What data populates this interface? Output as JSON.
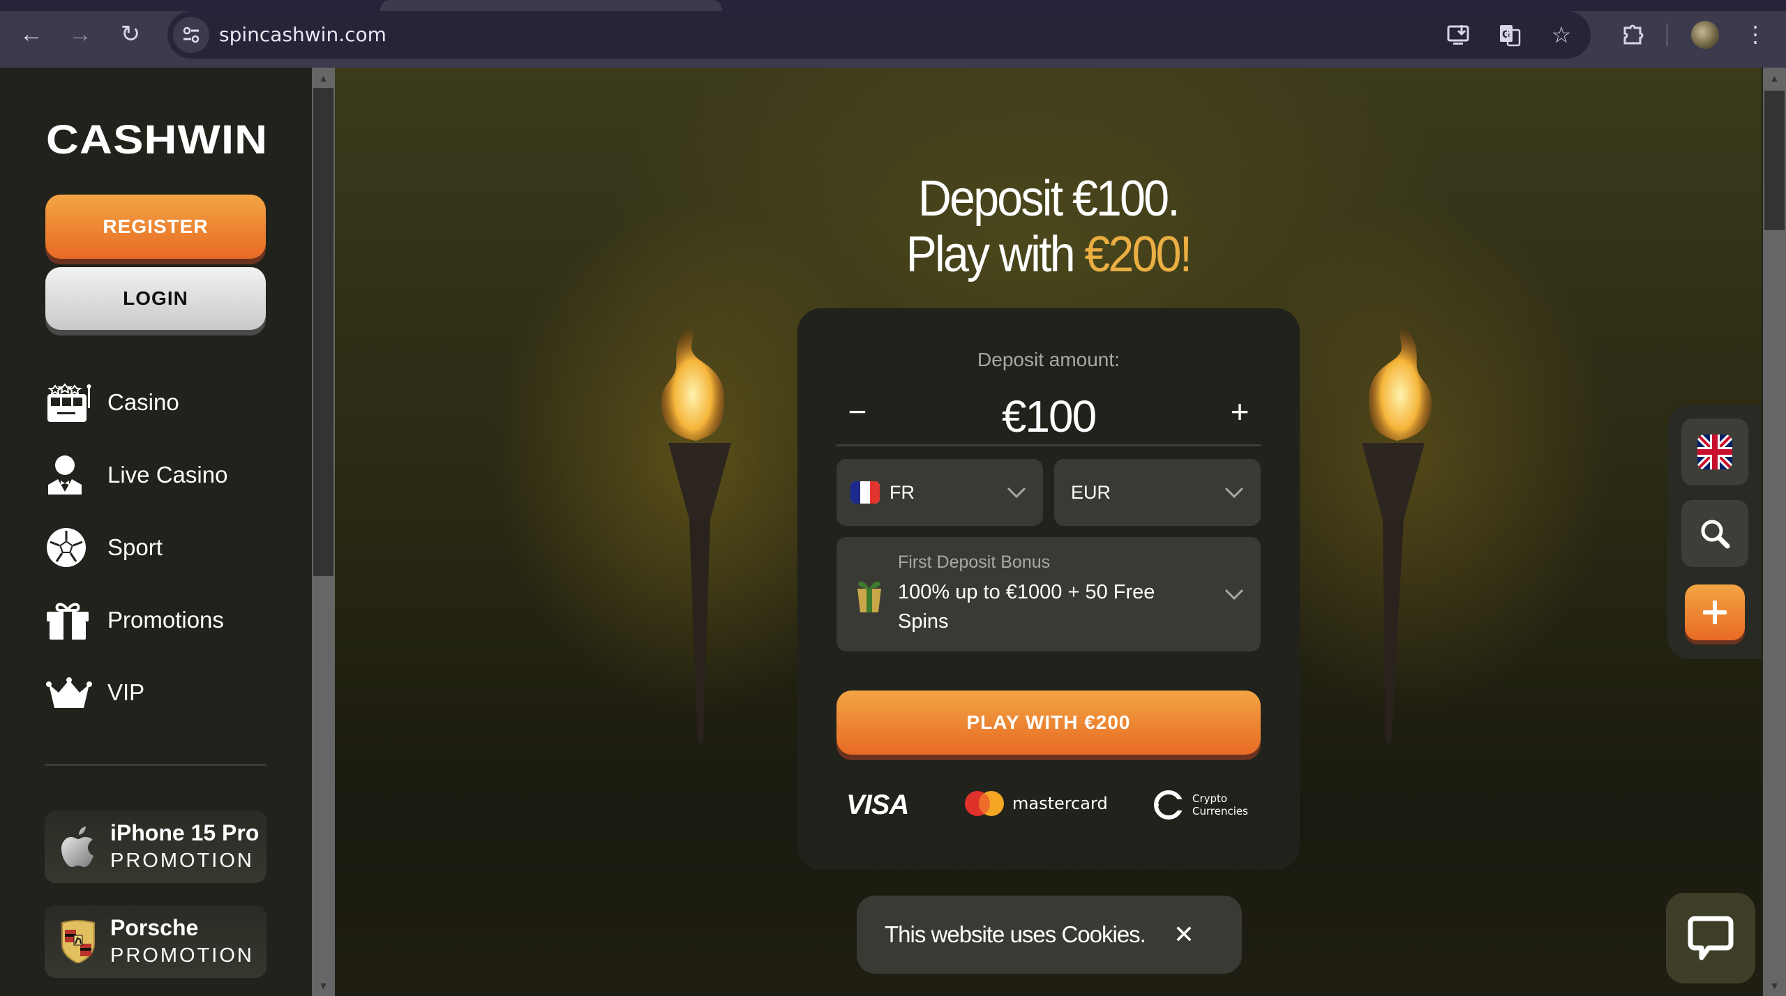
{
  "browser": {
    "url": "spincashwin.com",
    "back_icon": "arrow-left-icon",
    "forward_icon": "arrow-right-icon",
    "reload_icon": "reload-icon",
    "toolbar_icons": [
      "install-app-icon",
      "translate-icon",
      "bookmark-star-icon",
      "extensions-icon",
      "profile-avatar",
      "menu-kebab-icon"
    ]
  },
  "sidebar": {
    "logo": "CASHWIN",
    "register_label": "REGISTER",
    "login_label": "LOGIN",
    "nav": [
      {
        "label": "Casino",
        "icon": "slot-machine-icon"
      },
      {
        "label": "Live Casino",
        "icon": "dealer-icon"
      },
      {
        "label": "Sport",
        "icon": "soccer-ball-icon"
      },
      {
        "label": "Promotions",
        "icon": "gift-icon"
      },
      {
        "label": "VIP",
        "icon": "crown-icon"
      }
    ],
    "promos": [
      {
        "title": "iPhone 15 Pro",
        "subtitle": "PROMOTION",
        "icon": "apple-logo-icon"
      },
      {
        "title": "Porsche",
        "subtitle": "PROMOTION",
        "icon": "porsche-crest-icon"
      }
    ]
  },
  "hero": {
    "line1": "Deposit €100.",
    "line2_prefix": "Play with ",
    "line2_highlight": "€200!",
    "highlight_color": "#eaae43"
  },
  "deposit_card": {
    "label": "Deposit amount:",
    "amount": "€100",
    "minus": "−",
    "plus": "+",
    "country": "FR",
    "currency": "EUR",
    "bonus_title": "First Deposit Bonus",
    "bonus_text": "100% up to €1000 + 50 Free Spins",
    "cta": "PLAY WITH €200",
    "payments": {
      "visa": "VISA",
      "mastercard": "mastercard",
      "crypto_line1": "Crypto",
      "crypto_line2": "Currencies"
    }
  },
  "side_panel": {
    "language_icon": "uk-flag-icon",
    "search_icon": "search-icon",
    "add_icon": "plus-icon"
  },
  "cookie_banner": {
    "text": "This website uses Cookies.",
    "close": "✕"
  },
  "colors": {
    "accent_orange": "#e86a24",
    "sidebar_bg": "#21221c",
    "card_bg": "#21221c",
    "field_bg": "#393a34"
  }
}
